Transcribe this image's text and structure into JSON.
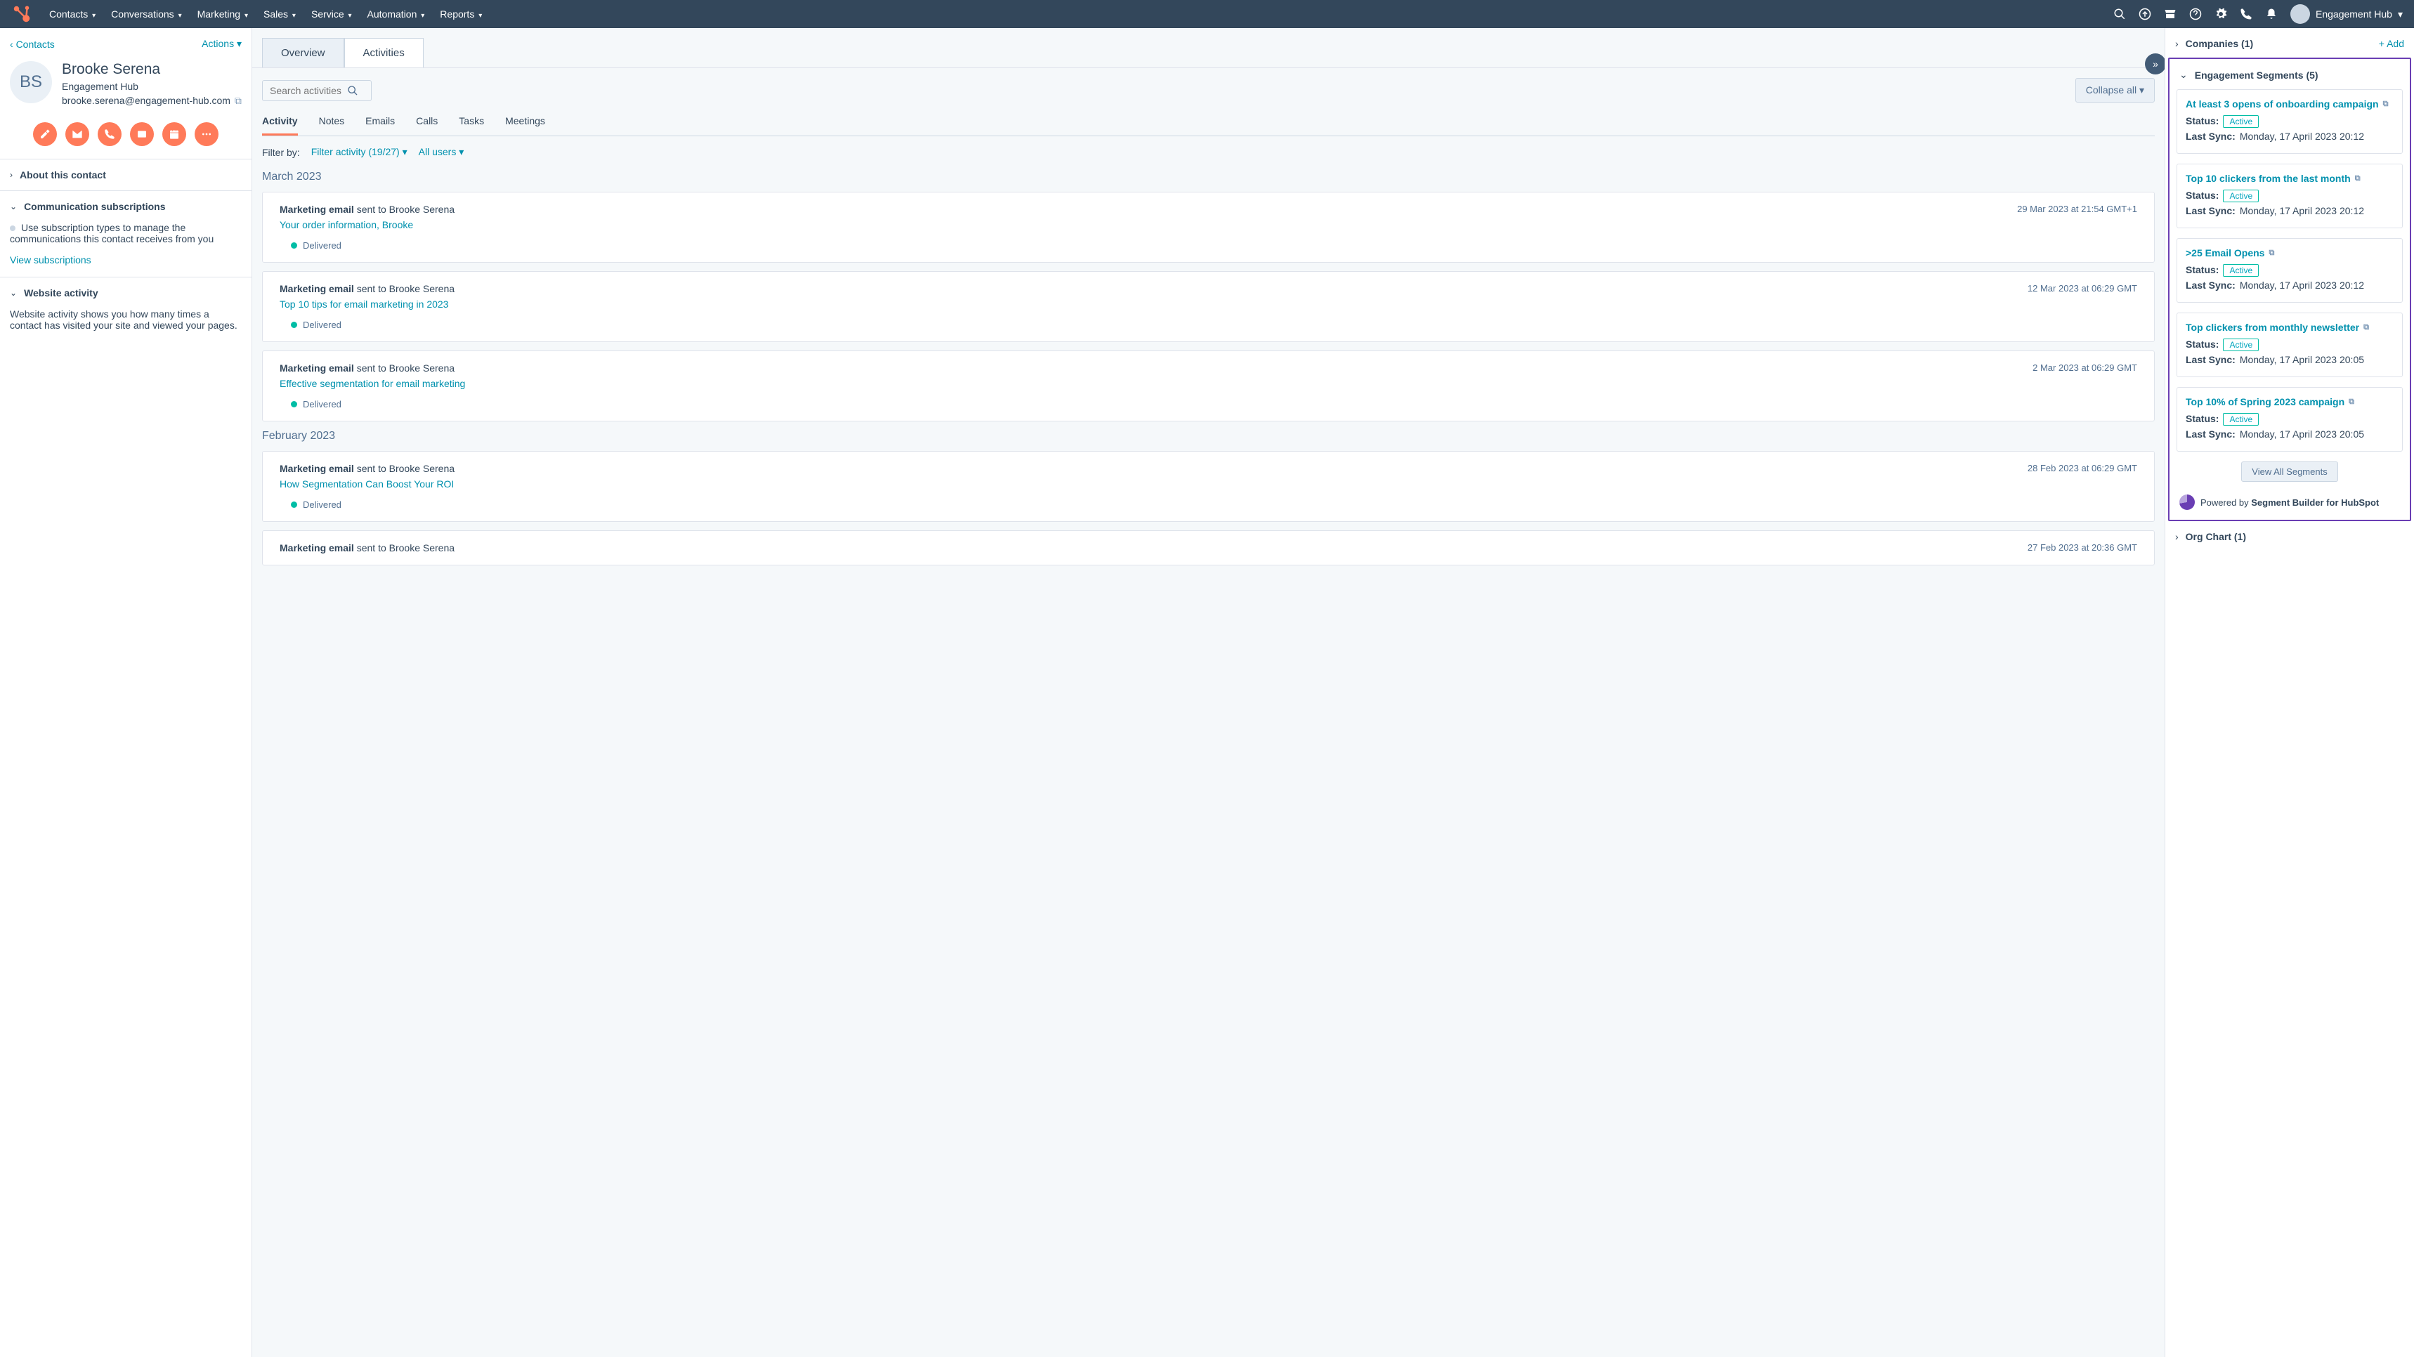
{
  "topnav": {
    "menu": [
      "Contacts",
      "Conversations",
      "Marketing",
      "Sales",
      "Service",
      "Automation",
      "Reports"
    ],
    "account": "Engagement Hub"
  },
  "left": {
    "back": "Contacts",
    "actions": "Actions",
    "initials": "BS",
    "name": "Brooke Serena",
    "org": "Engagement Hub",
    "email": "brooke.serena@engagement-hub.com",
    "sections": {
      "about": "About this contact",
      "comm_title": "Communication subscriptions",
      "comm_body": "Use subscription types to manage the communications this contact receives from you",
      "comm_link": "View subscriptions",
      "web_title": "Website activity",
      "web_body": "Website activity shows you how many times a contact has visited your site and viewed your pages."
    }
  },
  "mid": {
    "tabs": {
      "overview": "Overview",
      "activities": "Activities"
    },
    "search_placeholder": "Search activities",
    "collapse": "Collapse all",
    "subtabs": [
      "Activity",
      "Notes",
      "Emails",
      "Calls",
      "Tasks",
      "Meetings"
    ],
    "filter_label": "Filter by:",
    "filter_activity": "Filter activity (19/27)",
    "filter_users": "All users",
    "groups": [
      {
        "month": "March 2023",
        "items": [
          {
            "type": "Marketing email",
            "to": "sent to Brooke Serena <brooke.serena@engagement-hub.com>",
            "date": "29 Mar 2023 at 21:54 GMT+1",
            "subject": "Your order information, Brooke",
            "status": "Delivered"
          },
          {
            "type": "Marketing email",
            "to": "sent to Brooke Serena <brooke.serena@engagement-hub.com>",
            "date": "12 Mar 2023 at 06:29 GMT",
            "subject": "Top 10 tips for email marketing in 2023",
            "status": "Delivered"
          },
          {
            "type": "Marketing email",
            "to": "sent to Brooke Serena <brooke.serena@engagement-hub.com>",
            "date": "2 Mar 2023 at 06:29 GMT",
            "subject": "Effective segmentation for email marketing",
            "status": "Delivered"
          }
        ]
      },
      {
        "month": "February 2023",
        "items": [
          {
            "type": "Marketing email",
            "to": "sent to Brooke Serena <brooke.serena@engagement-hub.com>",
            "date": "28 Feb 2023 at 06:29 GMT",
            "subject": "How Segmentation Can Boost Your ROI",
            "status": "Delivered"
          },
          {
            "type": "Marketing email",
            "to": "sent to Brooke Serena <brooke.serena@engagement-hub.com>",
            "date": "27 Feb 2023 at 20:36 GMT",
            "subject": "",
            "status": ""
          }
        ]
      }
    ]
  },
  "right": {
    "companies": "Companies (1)",
    "add": "+ Add",
    "segments_title": "Engagement Segments (5)",
    "status_label": "Status:",
    "sync_label": "Last Sync:",
    "active": "Active",
    "segments": [
      {
        "title": "At least 3 opens of onboarding campaign",
        "sync": "Monday, 17 April 2023 20:12"
      },
      {
        "title": "Top 10 clickers from the last month",
        "sync": "Monday, 17 April 2023 20:12"
      },
      {
        "title": ">25 Email Opens",
        "sync": "Monday, 17 April 2023 20:12"
      },
      {
        "title": "Top clickers from monthly newsletter",
        "sync": "Monday, 17 April 2023 20:05"
      },
      {
        "title": "Top 10% of Spring 2023 campaign",
        "sync": "Monday, 17 April 2023 20:05"
      }
    ],
    "view_all": "View All Segments",
    "powered_prefix": "Powered by ",
    "powered_bold": "Segment Builder for HubSpot",
    "orgchart": "Org Chart (1)"
  }
}
